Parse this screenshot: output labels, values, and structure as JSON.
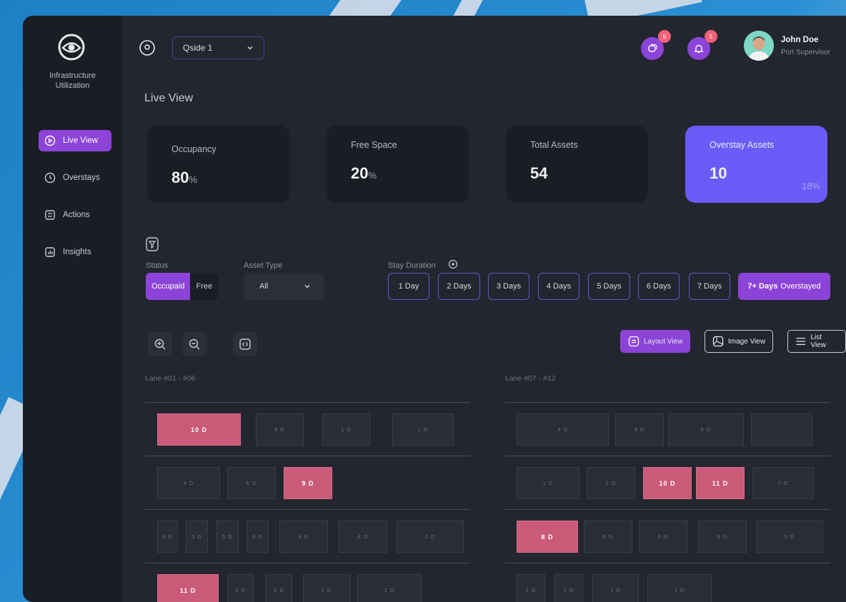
{
  "sidebar": {
    "brand_line1": "Infrastructure",
    "brand_line2": "Utilization",
    "items": [
      {
        "label": "Live View",
        "icon": "play-circle-icon",
        "active": true
      },
      {
        "label": "Overstays",
        "icon": "clock-icon",
        "active": false
      },
      {
        "label": "Actions",
        "icon": "checklist-icon",
        "active": false
      },
      {
        "label": "Insights",
        "icon": "bar-chart-icon",
        "active": false
      }
    ]
  },
  "header": {
    "site_selected": "Qside 1",
    "messages_count": "5",
    "notifications_count": "5",
    "user_name": "John Doe",
    "user_role": "Port Supervisor"
  },
  "page": {
    "title": "Live View"
  },
  "cards": [
    {
      "label": "Occupancy",
      "value": "80",
      "unit": "%"
    },
    {
      "label": "Free Space",
      "value": "20",
      "unit": "%"
    },
    {
      "label": "Total Assets",
      "value": "54"
    },
    {
      "label": "Overstay Assets",
      "value": "10",
      "extra": "18%"
    }
  ],
  "filters": {
    "status_label": "Status",
    "status_options": [
      "Occupaid",
      "Free"
    ],
    "asset_type_label": "Asset Type",
    "asset_type_value": "All",
    "stay_duration_label": "Stay Duration",
    "durations": [
      "1 Day",
      "2 Days",
      "3 Days",
      "4 Days",
      "5 Days",
      "6 Days",
      "7 Days"
    ],
    "overstay_bold": "7+ Days",
    "overstay_text": "Overstayed"
  },
  "views": {
    "layout": "Layout View",
    "image": "Image View",
    "list": "List View"
  },
  "lanes": [
    {
      "title": "Lane #01 - #06",
      "rows": [
        [
          "10 D",
          "4 D",
          "1 D",
          "1 D"
        ],
        [
          "4 D",
          "6 D",
          "9 D"
        ],
        [
          "5 D",
          "5 D",
          "5 D",
          "5 D",
          "4 D",
          "4 D",
          "1 D"
        ],
        [
          "11 D",
          "4 D",
          "4 D",
          "2 D",
          "2 D"
        ]
      ]
    },
    {
      "title": "Lane #07 - #12",
      "rows": [
        [
          "4 D",
          "4 D",
          "5 D",
          ""
        ],
        [
          "1 D",
          "2 D",
          "10 D",
          "11 D",
          "7 D"
        ],
        [
          "8 D",
          "5 D",
          "5 D",
          "5 D",
          "5 D"
        ],
        [
          "1 D",
          "1 D",
          "1 D",
          "1 D"
        ]
      ]
    }
  ],
  "colors": {
    "accent": "#8c44d8",
    "overstay": "#c95b78",
    "card_accent": "#6a5cf6",
    "badge": "#f06178"
  }
}
